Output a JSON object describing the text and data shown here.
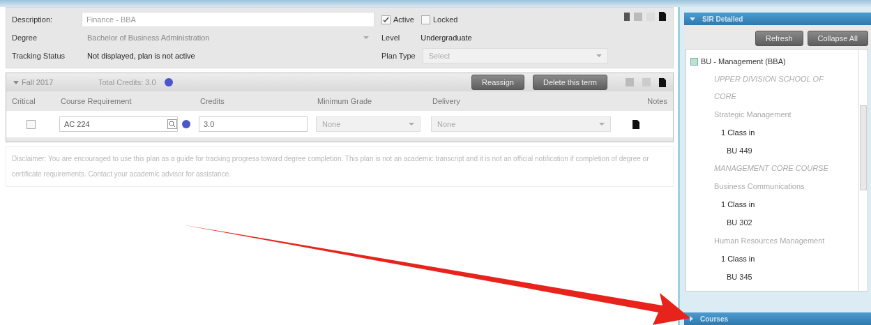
{
  "plan_form": {
    "description_label": "Description:",
    "description_value": "Finance - BBA",
    "active": {
      "label": "Active",
      "checked": true
    },
    "locked": {
      "label": "Locked",
      "checked": false
    },
    "degree_label": "Degree",
    "degree_value": "Bachelor of Business Administration",
    "level_label": "Level",
    "level_value": "Undergraduate",
    "tracking_label": "Tracking Status",
    "tracking_value": "Not displayed, plan is not active",
    "plan_type_label": "Plan Type",
    "plan_type_placeholder": "Select"
  },
  "term": {
    "name": "Fall 2017",
    "expanded": true,
    "total_credits": "Total Credits: 3.0",
    "buttons": [
      "Reassign",
      "Delete this term"
    ],
    "columns": [
      "Critical",
      "Course Requirement",
      "Credits",
      "Minimum Grade",
      "Delivery",
      "Notes"
    ],
    "rows": [
      {
        "critical": false,
        "course": "AC 224",
        "credits": "3.0",
        "minimum_grade": "None",
        "delivery": "None"
      }
    ]
  },
  "disclaimer": "Disclaimer: You are encouraged to use this plan as a guide for tracking progress toward degree completion. This plan is not an academic transcript and it is not an official notification if completion of degree or certificate requirements. Contact your academic advisor for assistance.",
  "side_panel": {
    "title": "SIR Detailed",
    "expanded": true,
    "buttons": [
      "Refresh",
      "Collapse All"
    ],
    "tree": [
      {
        "label": "BU - Management (BBA)",
        "kind": "program",
        "children": [
          {
            "label": "UPPER DIVISION SCHOOL OF CORE",
            "kind": "group",
            "children": [
              {
                "label": "Strategic Management",
                "kind": "requirement",
                "children": [
                  {
                    "label": "1 Class in",
                    "kind": "rule",
                    "children": [
                      {
                        "label": "BU 449",
                        "kind": "course"
                      }
                    ]
                  }
                ]
              }
            ]
          },
          {
            "label": "MANAGEMENT CORE COURSE",
            "kind": "group",
            "children": [
              {
                "label": "Business Communications",
                "kind": "requirement",
                "children": [
                  {
                    "label": "1 Class in",
                    "kind": "rule",
                    "children": [
                      {
                        "label": "BU 302",
                        "kind": "course"
                      }
                    ]
                  }
                ]
              },
              {
                "label": "Human Resources Management",
                "kind": "requirement",
                "children": [
                  {
                    "label": "1 Class in",
                    "kind": "rule",
                    "children": [
                      {
                        "label": "BU 345",
                        "kind": "course"
                      }
                    ]
                  }
                ]
              }
            ]
          }
        ]
      }
    ]
  },
  "bottom_panel": {
    "title": "Courses",
    "expanded": false
  }
}
